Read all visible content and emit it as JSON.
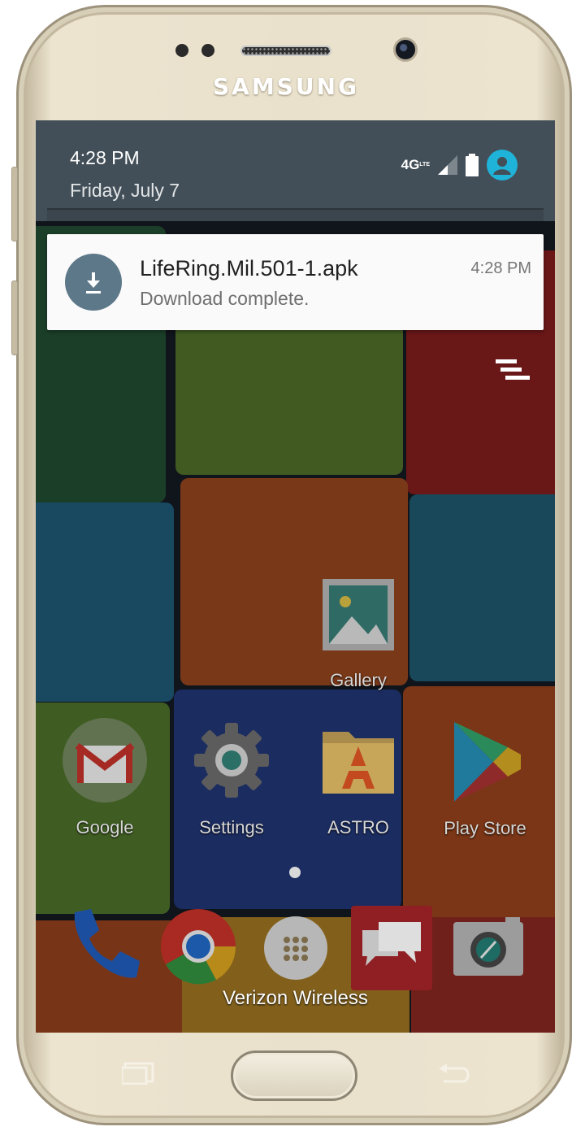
{
  "device": {
    "brand": "SAMSUNG"
  },
  "status_bar": {
    "time": "4:28 PM",
    "date": "Friday, July 7",
    "network": "4G",
    "network_sub": "LTE"
  },
  "notification": {
    "title": "LifeRing.Mil.501-1.apk",
    "text": "Download complete.",
    "time": "4:28 PM",
    "icon": "download-icon",
    "icon_color": "#5d7888"
  },
  "home_screen": {
    "apps": [
      {
        "label": "Gallery",
        "icon": "gallery-icon"
      },
      {
        "label": "Google",
        "icon": "gmail-icon"
      },
      {
        "label": "Settings",
        "icon": "settings-gear-icon"
      },
      {
        "label": "ASTRO",
        "icon": "astro-folder-icon"
      },
      {
        "label": "Play Store",
        "icon": "play-store-icon"
      }
    ],
    "dock": [
      {
        "icon": "phone-icon"
      },
      {
        "icon": "chrome-icon"
      },
      {
        "icon": "app-drawer-icon"
      },
      {
        "icon": "messages-icon"
      },
      {
        "icon": "camera-icon"
      }
    ],
    "carrier": "Verizon Wireless"
  },
  "colors": {
    "shade_header": "#434f58",
    "avatar": "#1fb3d9",
    "notification_bg": "#fafafa"
  }
}
